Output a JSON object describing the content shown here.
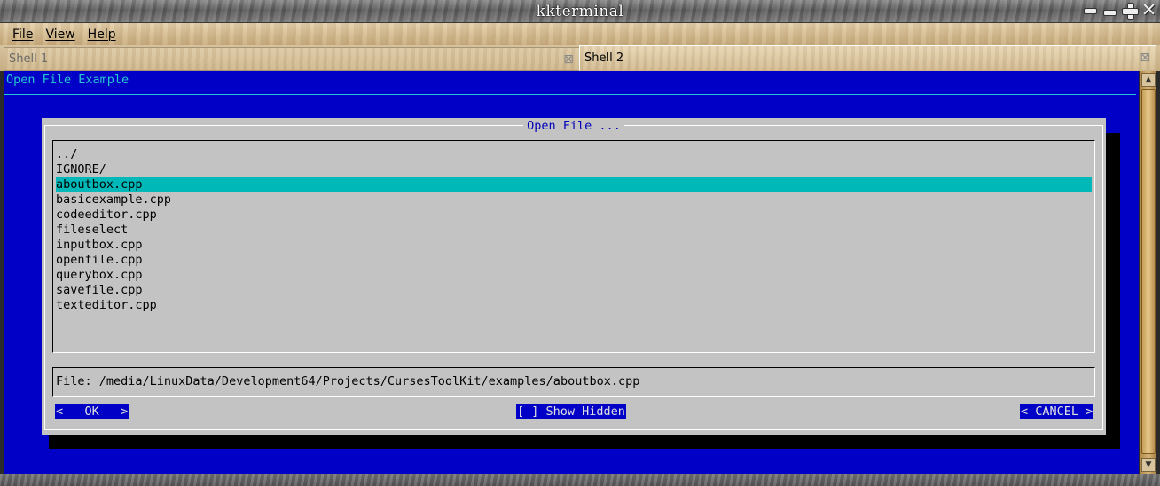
{
  "window": {
    "title": "kkterminal",
    "controls": {
      "close": "✕"
    }
  },
  "menu": {
    "items": [
      "File",
      "View",
      "Help"
    ]
  },
  "tabs": [
    {
      "label": "Shell 1",
      "active": false,
      "close": "⊠"
    },
    {
      "label": "Shell 2",
      "active": true,
      "close": "⊠"
    }
  ],
  "terminal": {
    "title": "Open File Example"
  },
  "scrollbar": {
    "up": "▲",
    "down": "▼"
  },
  "dialog": {
    "title": "Open File ...",
    "files": [
      "../",
      "IGNORE/",
      "aboutbox.cpp",
      "basicexample.cpp",
      "codeeditor.cpp",
      "fileselect",
      "inputbox.cpp",
      "openfile.cpp",
      "querybox.cpp",
      "savefile.cpp",
      "texteditor.cpp"
    ],
    "selected_index": 2,
    "path": "File: /media/LinuxData/Development64/Projects/CursesToolKit/examples/aboutbox.cpp",
    "buttons": {
      "ok": "<   OK   >",
      "show_hidden": "[ ] Show Hidden",
      "cancel": "< CANCEL >"
    },
    "colors": {
      "background": "#c3c3c3",
      "selection": "#00b8b8",
      "button_bg": "#0000c6",
      "title": "#0000b8"
    }
  },
  "colors": {
    "terminal_bg": "#0000c6",
    "terminal_fg": "#28c8d0"
  }
}
